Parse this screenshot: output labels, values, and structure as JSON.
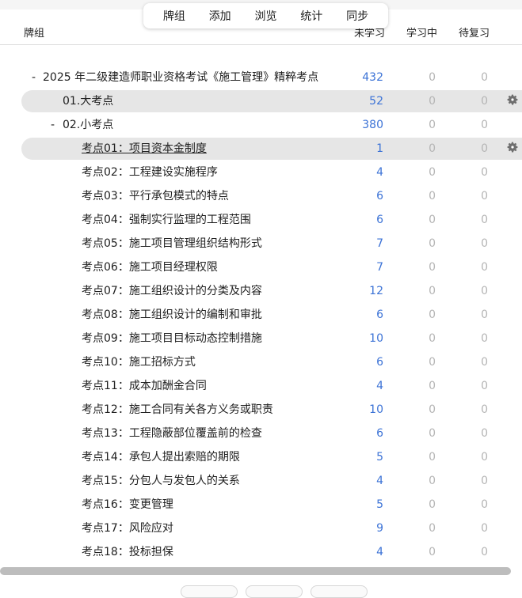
{
  "nav": {
    "decks": "牌组",
    "add": "添加",
    "browse": "浏览",
    "stats": "统计",
    "sync": "同步"
  },
  "header": {
    "deck": "牌组",
    "new": "未学习",
    "learn": "学习中",
    "due": "待复习"
  },
  "colors": {
    "new_count": "#3b72d6",
    "zero_count": "#b5b5b5",
    "selected_row": "#e6e6e6"
  },
  "rows": [
    {
      "collapse": "-",
      "name": "2025 年二级建造师职业资格考试《施工管理》精粹考点",
      "new": "432",
      "learn": "0",
      "due": "0"
    },
    {
      "collapse": "",
      "name": "01.大考点",
      "new": "52",
      "learn": "0",
      "due": "0",
      "selected": true,
      "gear": true
    },
    {
      "collapse": "-",
      "name": "02.小考点",
      "new": "380",
      "learn": "0",
      "due": "0"
    },
    {
      "name": "考点01：项目资本金制度",
      "new": "1",
      "learn": "0",
      "due": "0",
      "selected": true,
      "gear": true,
      "current": true
    },
    {
      "name": "考点02：工程建设实施程序",
      "new": "4",
      "learn": "0",
      "due": "0"
    },
    {
      "name": "考点03：平行承包模式的特点",
      "new": "6",
      "learn": "0",
      "due": "0"
    },
    {
      "name": "考点04：强制实行监理的工程范围",
      "new": "6",
      "learn": "0",
      "due": "0"
    },
    {
      "name": "考点05：施工项目管理组织结构形式",
      "new": "7",
      "learn": "0",
      "due": "0"
    },
    {
      "name": "考点06：施工项目经理权限",
      "new": "7",
      "learn": "0",
      "due": "0"
    },
    {
      "name": "考点07：施工组织设计的分类及内容",
      "new": "12",
      "learn": "0",
      "due": "0"
    },
    {
      "name": "考点08：施工组织设计的编制和审批",
      "new": "6",
      "learn": "0",
      "due": "0"
    },
    {
      "name": "考点09：施工项目目标动态控制措施",
      "new": "10",
      "learn": "0",
      "due": "0"
    },
    {
      "name": "考点10：施工招标方式",
      "new": "6",
      "learn": "0",
      "due": "0"
    },
    {
      "name": "考点11：成本加酬金合同",
      "new": "4",
      "learn": "0",
      "due": "0"
    },
    {
      "name": "考点12：施工合同有关各方义务或职责",
      "new": "10",
      "learn": "0",
      "due": "0"
    },
    {
      "name": "考点13：工程隐蔽部位覆盖前的检查",
      "new": "6",
      "learn": "0",
      "due": "0"
    },
    {
      "name": "考点14：承包人提出索赔的期限",
      "new": "5",
      "learn": "0",
      "due": "0"
    },
    {
      "name": "考点15：分包人与发包人的关系",
      "new": "4",
      "learn": "0",
      "due": "0"
    },
    {
      "name": "考点16：变更管理",
      "new": "5",
      "learn": "0",
      "due": "0"
    },
    {
      "name": "考点17：风险应对",
      "new": "9",
      "learn": "0",
      "due": "0"
    },
    {
      "name": "考点18：投标担保",
      "new": "4",
      "learn": "0",
      "due": "0"
    }
  ]
}
